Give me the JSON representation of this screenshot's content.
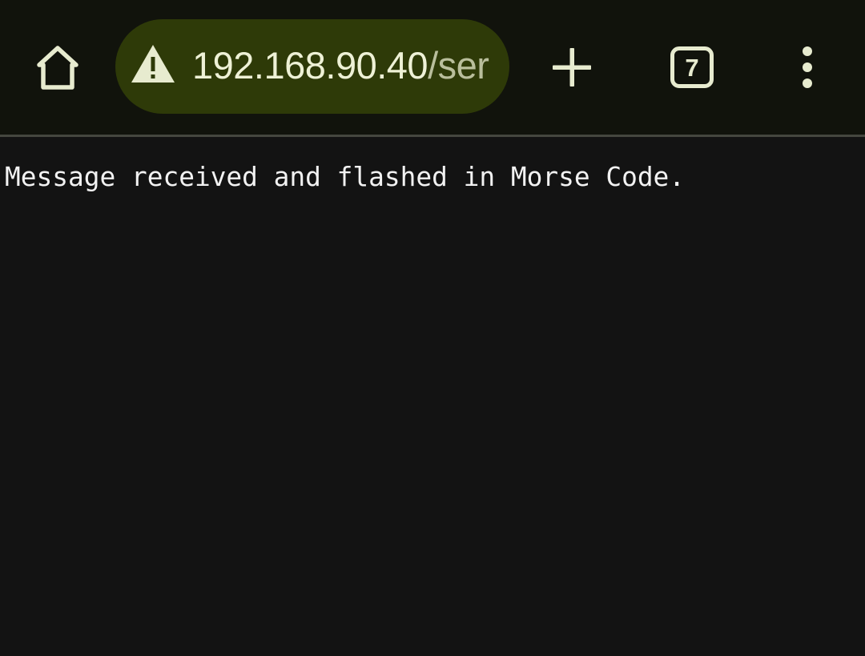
{
  "browser": {
    "toolbar": {
      "home_icon": "home-icon",
      "new_tab_icon": "plus-icon",
      "menu_icon": "more-vert-icon",
      "tab_count": "7"
    },
    "omnibox": {
      "security_icon": "warning-icon",
      "url_host": "192.168.90.40",
      "url_path": "/ser"
    },
    "colors": {
      "toolbar_bg": "#11130c",
      "omnibox_bg": "#2e3a08",
      "icon_color": "#e7ebcf",
      "page_bg": "#131313",
      "text": "#f2f2f2"
    }
  },
  "page": {
    "message": "Message received and flashed in Morse Code."
  }
}
